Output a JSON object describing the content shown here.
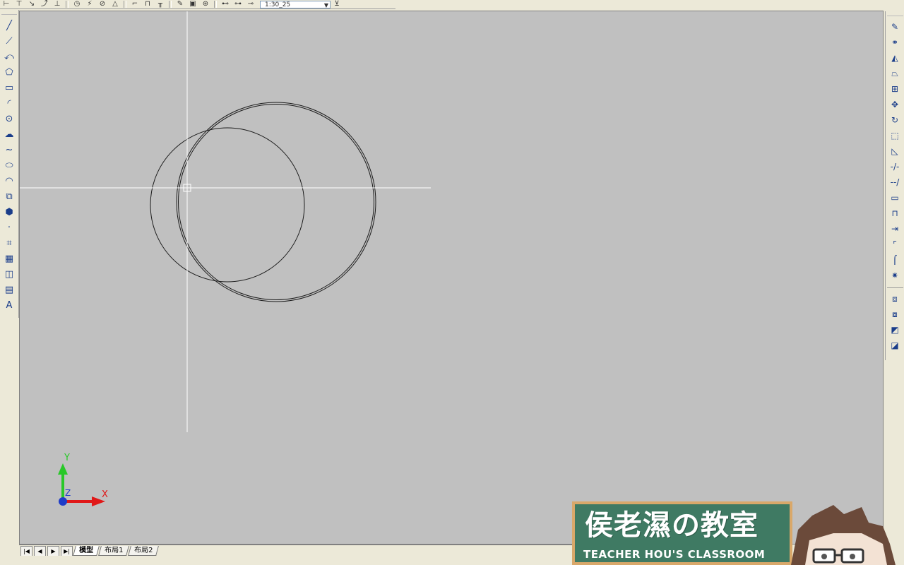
{
  "toolbar": {
    "combo_value": "1:30_25"
  },
  "left_tools": [
    {
      "icon": "line-icon",
      "glyph": "╱"
    },
    {
      "icon": "construction-line-icon",
      "glyph": "⟋"
    },
    {
      "icon": "polyline-icon",
      "glyph": "⤺"
    },
    {
      "icon": "polygon-icon",
      "glyph": "⬠"
    },
    {
      "icon": "rectangle-icon",
      "glyph": "▭"
    },
    {
      "icon": "arc-icon",
      "glyph": "◜"
    },
    {
      "icon": "circle-icon",
      "glyph": "⊙"
    },
    {
      "icon": "revision-cloud-icon",
      "glyph": "☁"
    },
    {
      "icon": "spline-icon",
      "glyph": "∼"
    },
    {
      "icon": "ellipse-icon",
      "glyph": "⬭"
    },
    {
      "icon": "ellipse-arc-icon",
      "glyph": "◠"
    },
    {
      "icon": "insert-block-icon",
      "glyph": "⧉"
    },
    {
      "icon": "make-block-icon",
      "glyph": "⬢"
    },
    {
      "icon": "point-icon",
      "glyph": "·"
    },
    {
      "icon": "hatch-icon",
      "glyph": "⌗"
    },
    {
      "icon": "gradient-icon",
      "glyph": "▦"
    },
    {
      "icon": "region-icon",
      "glyph": "◫"
    },
    {
      "icon": "table-icon",
      "glyph": "▤"
    },
    {
      "icon": "multiline-text-icon",
      "glyph": "A"
    }
  ],
  "right_tools_a": [
    {
      "icon": "erase-icon",
      "glyph": "✎"
    },
    {
      "icon": "copy-icon",
      "glyph": "⚭"
    },
    {
      "icon": "mirror-icon",
      "glyph": "◭"
    },
    {
      "icon": "offset-icon",
      "glyph": "⏢"
    },
    {
      "icon": "array-icon",
      "glyph": "⊞"
    },
    {
      "icon": "move-icon",
      "glyph": "✥"
    },
    {
      "icon": "rotate-icon",
      "glyph": "↻"
    },
    {
      "icon": "scale-icon",
      "glyph": "⬚"
    },
    {
      "icon": "stretch-icon",
      "glyph": "◺"
    },
    {
      "icon": "trim-icon",
      "glyph": "-/-"
    },
    {
      "icon": "extend-icon",
      "glyph": "--/"
    },
    {
      "icon": "break-at-point-icon",
      "glyph": "▭"
    },
    {
      "icon": "break-icon",
      "glyph": "⊓"
    },
    {
      "icon": "join-icon",
      "glyph": "⇥"
    },
    {
      "icon": "chamfer-icon",
      "glyph": "⌜"
    },
    {
      "icon": "fillet-icon",
      "glyph": "⌠"
    },
    {
      "icon": "explode-icon",
      "glyph": "✷"
    }
  ],
  "right_tools_b": [
    {
      "icon": "bring-to-front-icon",
      "glyph": "⧈"
    },
    {
      "icon": "send-to-back-icon",
      "glyph": "⧇"
    },
    {
      "icon": "bring-above-icon",
      "glyph": "◩"
    },
    {
      "icon": "send-under-icon",
      "glyph": "◪"
    }
  ],
  "ucs": {
    "x_label": "X",
    "y_label": "Y",
    "z_label": "Z"
  },
  "tabs": {
    "nav": [
      "|◀",
      "◀",
      "▶",
      "▶|"
    ],
    "items": [
      {
        "label": "模型",
        "active": true
      },
      {
        "label": "布局1",
        "active": false
      },
      {
        "label": "布局2",
        "active": false
      }
    ]
  },
  "watermark": {
    "title": "侯老濕の教室",
    "subtitle": "TEACHER HOU'S CLASSROOM"
  }
}
